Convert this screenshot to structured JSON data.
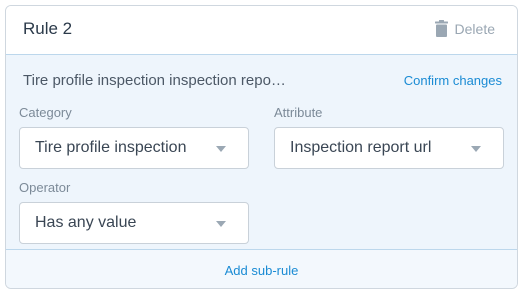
{
  "header": {
    "title": "Rule 2",
    "delete_label": "Delete",
    "delete_icon": "trash-icon"
  },
  "summary": {
    "text": "Tire profile inspection inspection repo…",
    "confirm_label": "Confirm changes"
  },
  "fields": {
    "category": {
      "label": "Category",
      "value": "Tire profile inspection"
    },
    "attribute": {
      "label": "Attribute",
      "value": "Inspection report url"
    },
    "operator": {
      "label": "Operator",
      "value": "Has any value"
    }
  },
  "footer": {
    "add_label": "Add sub-rule"
  },
  "colors": {
    "accent": "#1a8bd4",
    "body_background": "#eef5fc",
    "muted": "#9aa7b3"
  }
}
